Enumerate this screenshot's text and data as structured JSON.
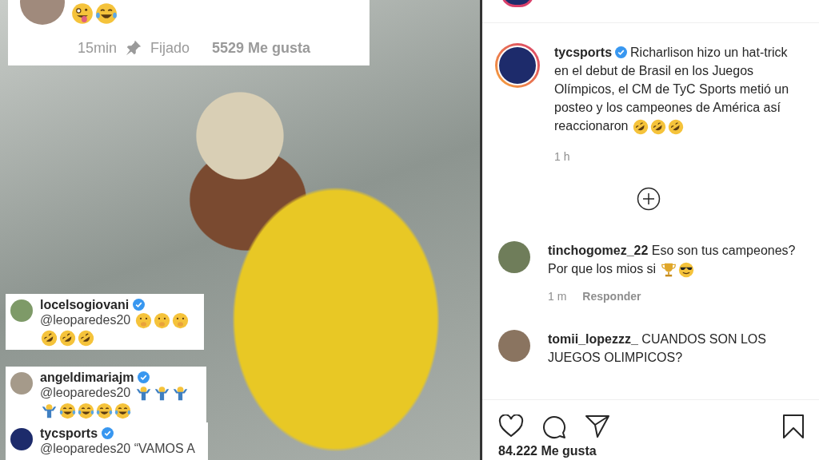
{
  "pinned_comment": {
    "emojis": [
      {
        "kind": "zany"
      },
      {
        "kind": "joy"
      }
    ],
    "time": "15min",
    "pinned_label": "Fijado",
    "likes": "5529 Me gusta"
  },
  "overlay_comments": [
    {
      "username": "locelsogiovani",
      "verified": true,
      "text": "@leoparedes20",
      "emojis": [
        {
          "kind": "shush"
        },
        {
          "kind": "shush"
        },
        {
          "kind": "shush"
        },
        {
          "kind": "rofl"
        },
        {
          "kind": "rofl"
        },
        {
          "kind": "rofl"
        }
      ]
    },
    {
      "username": "angeldimariajm",
      "verified": true,
      "text": "@leoparedes20",
      "emojis": [
        {
          "kind": "shrug"
        },
        {
          "kind": "shrug"
        },
        {
          "kind": "shrug"
        },
        {
          "kind": "shrug"
        },
        {
          "kind": "joy"
        },
        {
          "kind": "joy"
        },
        {
          "kind": "joy"
        },
        {
          "kind": "joy"
        }
      ]
    },
    {
      "username": "tycsports",
      "verified": true,
      "text": "@leoparedes20 “VAMOS A"
    }
  ],
  "post": {
    "username": "tycsports",
    "verified": true,
    "caption": "Richarlison hizo un hat-trick en el debut de Brasil en los Juegos Olímpicos, el CM de TyC Sports metió un posteo y los campeones de América así reaccionaron",
    "emojis": [
      {
        "kind": "rofl"
      },
      {
        "kind": "rofl"
      },
      {
        "kind": "rofl"
      }
    ],
    "time": "1 h"
  },
  "comments": [
    {
      "username": "tinchogomez_22",
      "text": "Eso son tus campeones? Por que los mios si",
      "emojis": [
        {
          "kind": "trophy"
        },
        {
          "kind": "sunglasses"
        }
      ],
      "time": "1 m",
      "reply_label": "Responder"
    },
    {
      "username": "tomii_lopezzz_",
      "text": "CUANDOS SON LOS JUEGOS OLIMPICOS?"
    }
  ],
  "likes": "84.222 Me gusta"
}
